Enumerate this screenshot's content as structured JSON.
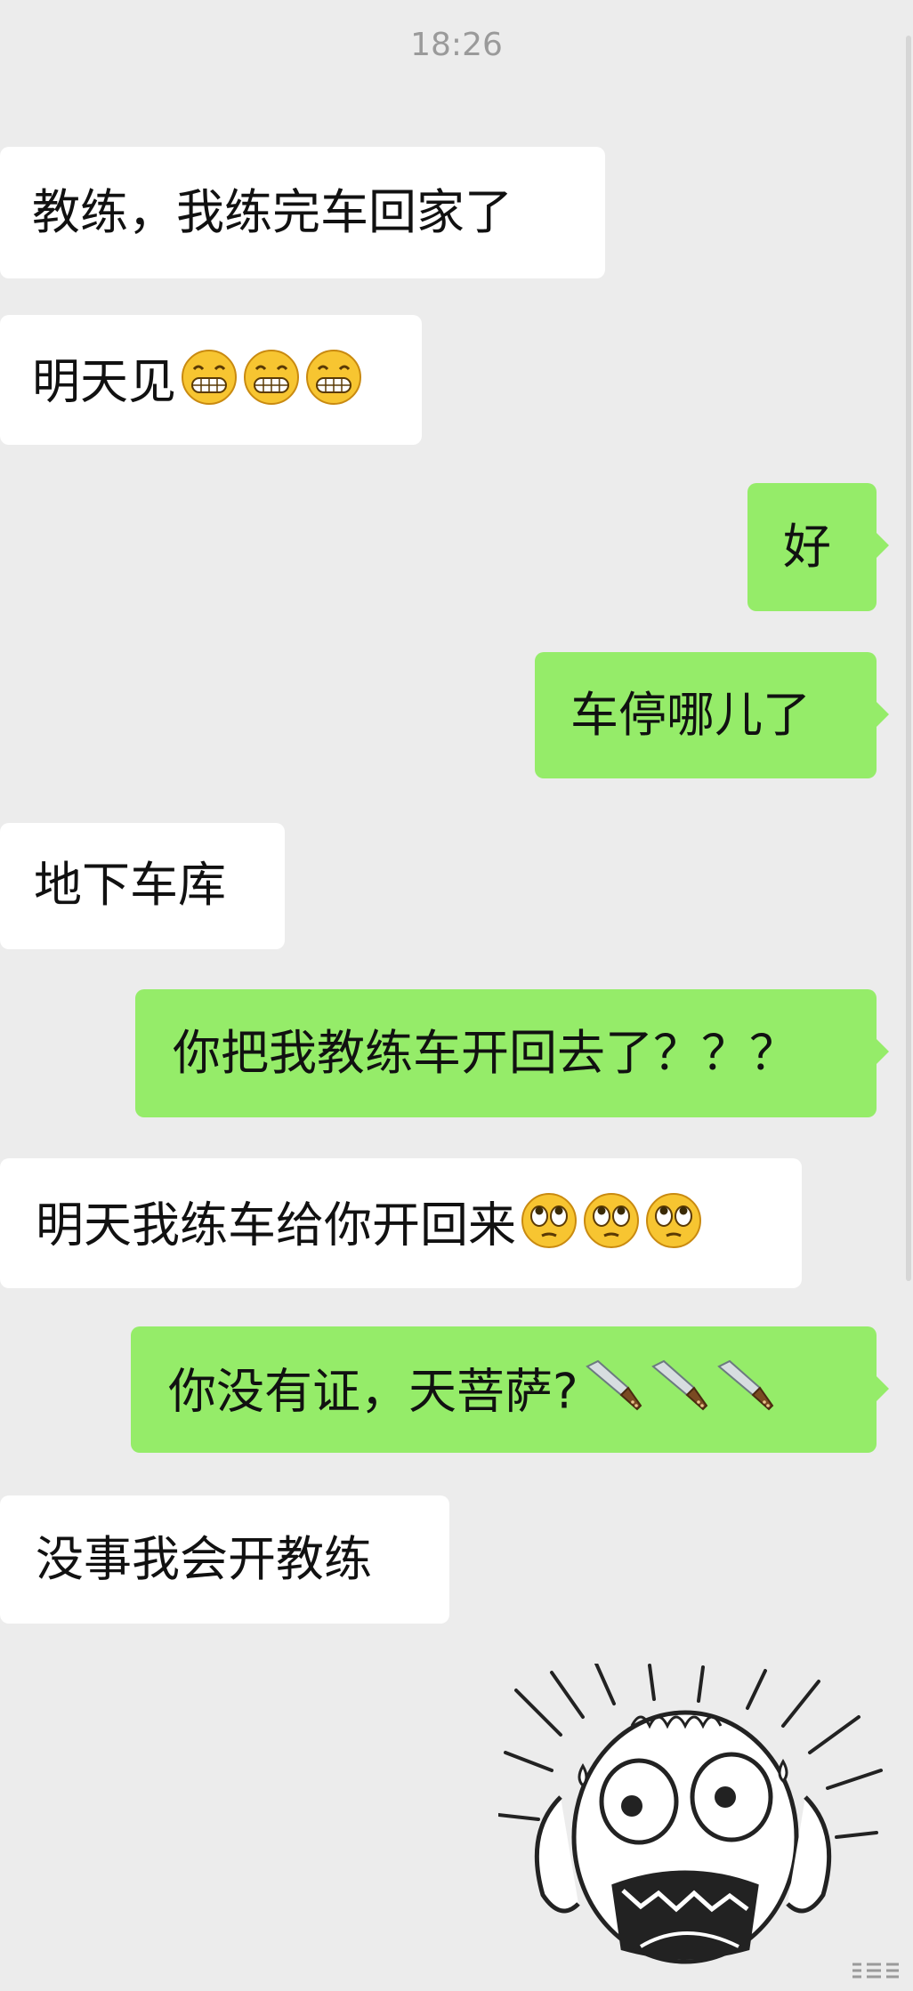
{
  "status": {
    "time": "18:26"
  },
  "messages": [
    {
      "side": "in",
      "text": "教练，我练完车回家了"
    },
    {
      "side": "in",
      "text": "明天见",
      "emoji": [
        "grin-icon",
        "grin-icon",
        "grin-icon"
      ]
    },
    {
      "side": "out",
      "text": "好"
    },
    {
      "side": "out",
      "text": "车停哪儿了"
    },
    {
      "side": "in",
      "text": "地下车库"
    },
    {
      "side": "out",
      "text": "你把我教练车开回去了？？？"
    },
    {
      "side": "in",
      "text": "明天我练车给你开回来",
      "emoji": [
        "rolling-eyes-icon",
        "rolling-eyes-icon",
        "rolling-eyes-icon"
      ]
    },
    {
      "side": "out",
      "text": "你没有证，天菩萨?",
      "emoji": [
        "kitchen-knife-icon",
        "kitchen-knife-icon",
        "kitchen-knife-icon"
      ]
    },
    {
      "side": "in",
      "text": "没事我会开教练"
    }
  ],
  "colors": {
    "background": "#ececec",
    "incoming_bubble": "#ffffff",
    "outgoing_bubble": "#95ec69",
    "timestamp": "#9a9a9a"
  },
  "sticker": {
    "icon": "shocked-cartoon-face-sticker"
  }
}
